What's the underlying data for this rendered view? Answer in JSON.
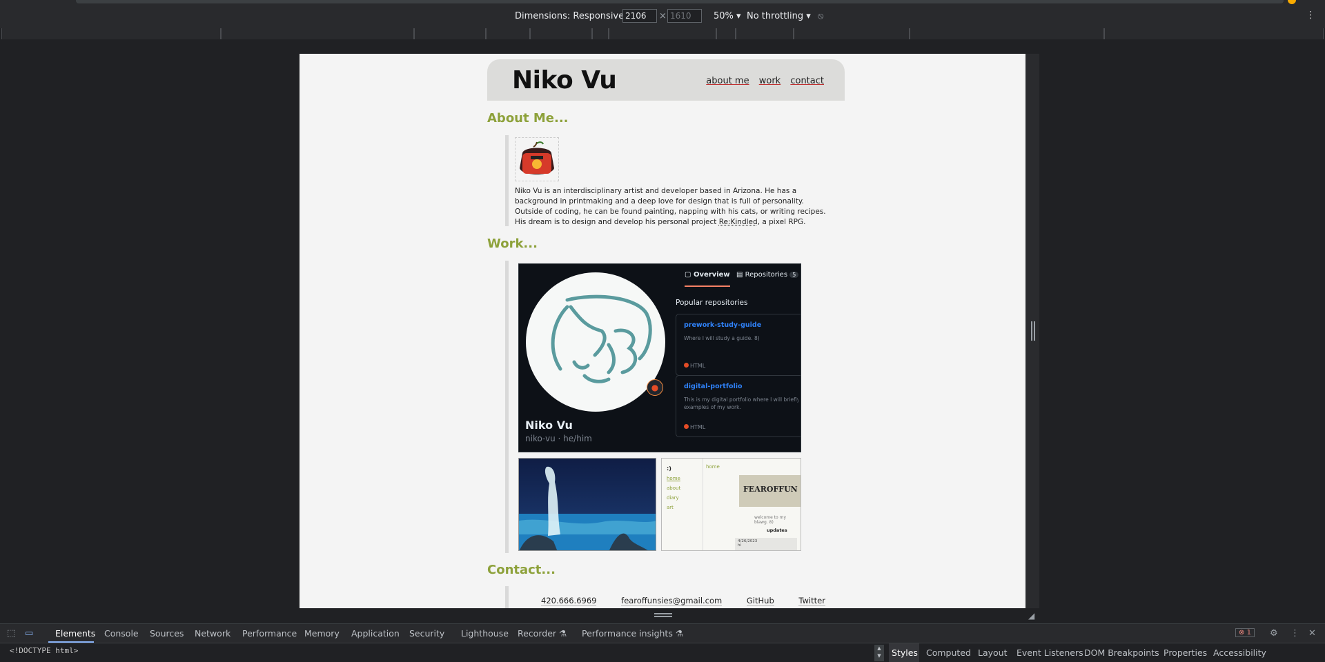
{
  "device_toolbar": {
    "dimensions_label": "Dimensions: Responsive",
    "width_value": "2106",
    "height_value": "1610",
    "zoom": "50%",
    "throttling": "No throttling"
  },
  "site": {
    "title": "Niko Vu",
    "nav": [
      "about me",
      "work",
      "contact"
    ],
    "about_heading": "About Me...",
    "about_text_before_link": "Niko Vu is an interdisciplinary artist and developer based in Arizona. He has a background in printmaking and a deep love for design that is full of personality. Outside of coding, he can be found painting, napping with his cats, or writing recipes. His dream is to design and develop his personal project ",
    "about_link": "Re:Kindled",
    "about_text_after_link": ", a pixel RPG.",
    "work_heading": "Work...",
    "contact_heading": "Contact...",
    "contact_items": [
      "420.666.6969",
      "fearoffunsies@gmail.com",
      "GitHub",
      "Twitter"
    ]
  },
  "github_card": {
    "tab_overview": "Overview",
    "tab_repositories": "Repositories",
    "repo_count": "5",
    "name": "Niko Vu",
    "handle": "niko-vu · he/him",
    "popular_label": "Popular repositories",
    "repos": [
      {
        "name": "prework-study-guide",
        "desc": "Where I will study a guide. 8)",
        "lang": "HTML"
      },
      {
        "name": "digital-portfolio",
        "desc": "This is my digital portfolio where I will briefly sh",
        "desc2": "examples of my work.",
        "lang": "HTML"
      }
    ]
  },
  "blog_card": {
    "smile": ":)",
    "nav": [
      "home",
      "about",
      "diary",
      "art"
    ],
    "crumb": "home",
    "banner": "FEAROFFUN",
    "welcome": "welcome to my blawg. 8)",
    "updates": "updates",
    "date_line1": "4/26/2023",
    "date_line2": "hi"
  },
  "devtools": {
    "tabs": [
      "Elements",
      "Console",
      "Sources",
      "Network",
      "Performance",
      "Memory",
      "Application",
      "Security",
      "Lighthouse",
      "Recorder",
      "Performance insights"
    ],
    "error_count": "1",
    "doctype": "<!DOCTYPE html>",
    "side_tabs": [
      "Styles",
      "Computed",
      "Layout",
      "Event Listeners",
      "DOM Breakpoints",
      "Properties",
      "Accessibility"
    ]
  }
}
